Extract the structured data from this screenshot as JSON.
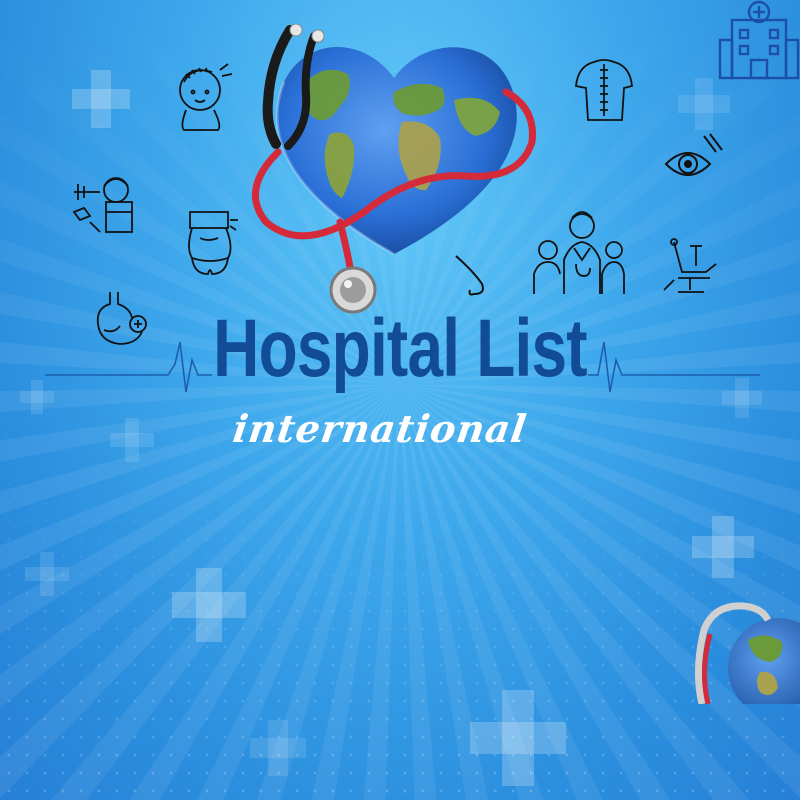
{
  "banner": {
    "title": "Hospital List",
    "subtitle": "international"
  },
  "colors": {
    "background_light": "#62c8f8",
    "background_dark": "#2680d6",
    "title": "#124b96",
    "subtitle": "#ffffff",
    "stethoscope_tube": "#d42a3a",
    "ocean": "#2a6fd6",
    "land": "#6b9a3a"
  },
  "icons": [
    "hospital-building-icon",
    "hair-transplant-icon",
    "spine-icon",
    "eye-icon",
    "dental-treatment-icon",
    "body-contouring-icon",
    "rhinoplasty-icon",
    "medical-team-icon",
    "dental-chair-icon",
    "stomach-icon",
    "stethoscope-icon",
    "heart-globe-icon",
    "heartbeat-line-icon",
    "medical-cross-icon"
  ]
}
